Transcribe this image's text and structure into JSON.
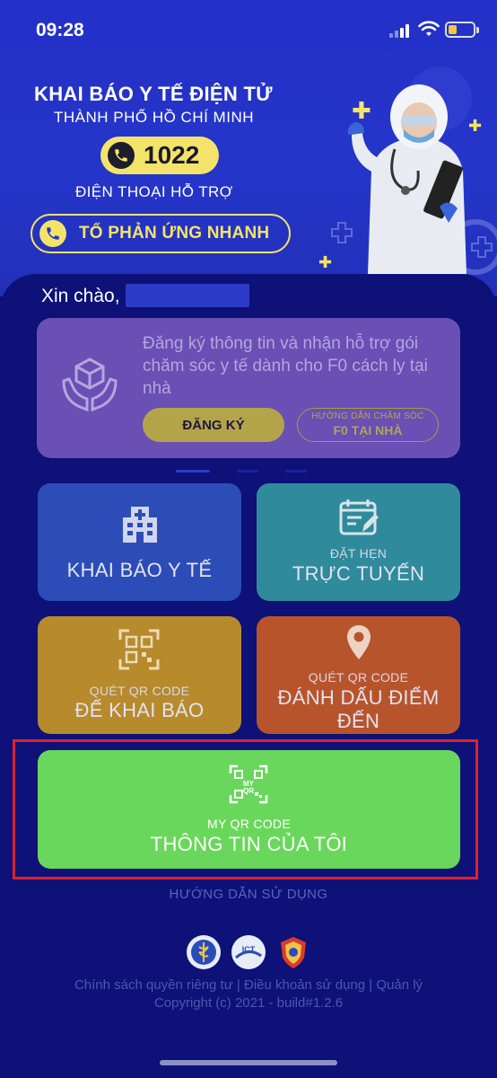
{
  "status_bar": {
    "time": "09:28"
  },
  "header": {
    "title": "KHAI BÁO Y TẾ ĐIỆN TỬ",
    "subtitle": "THÀNH PHỐ HỒ CHÍ MINH",
    "hotline": "1022",
    "support_label": "ĐIỆN THOẠI HỖ TRỢ",
    "quick_response_label": "TỔ PHẢN ỨNG NHANH"
  },
  "greeting": "Xin chào,",
  "promo": {
    "text": "Đăng ký thông tin và nhận hỗ trợ gói chăm sóc y tế dành cho F0 cách ly tại nhà",
    "register_label": "ĐĂNG KÝ",
    "guide_line1": "HƯỚNG DẪN CHĂM SÓC",
    "guide_line2": "F0 TẠI NHÀ"
  },
  "tiles": {
    "declare": {
      "label": "KHAI BÁO Y TẾ",
      "color": "#2c4cb7"
    },
    "booking": {
      "small": "ĐẶT HẸN",
      "label": "TRỰC TUYẾN",
      "color": "#2f8a9c"
    },
    "scan_declare": {
      "small": "QUÉT QR CODE",
      "label": "ĐỂ KHAI BÁO",
      "color": "#b78a2c"
    },
    "scan_mark": {
      "small": "QUÉT QR CODE",
      "label_line1": "ĐÁNH DẤU ĐIỂM",
      "label_line2": "ĐẾN",
      "color": "#b8542c"
    },
    "my_qr": {
      "icon_text_1": "MY",
      "icon_text_2": "QR",
      "small": "MY QR CODE",
      "label": "THÔNG TIN CỦA TÔI",
      "color": "#69d75b"
    }
  },
  "usage_guide": "HƯỚNG DẪN SỬ DỤNG",
  "logos": {
    "ict_text": "ICT"
  },
  "footer": {
    "links": "Chính sách quyền riêng tư | Điều khoản sử dụng | Quản lý",
    "copyright": "Copyright (c) 2021 - build#1.2.6"
  },
  "colors": {
    "accent_yellow": "#f4e36a",
    "highlight_red": "#e1202c",
    "header_blue": "#2535c9",
    "card_navy": "#0d1178"
  }
}
